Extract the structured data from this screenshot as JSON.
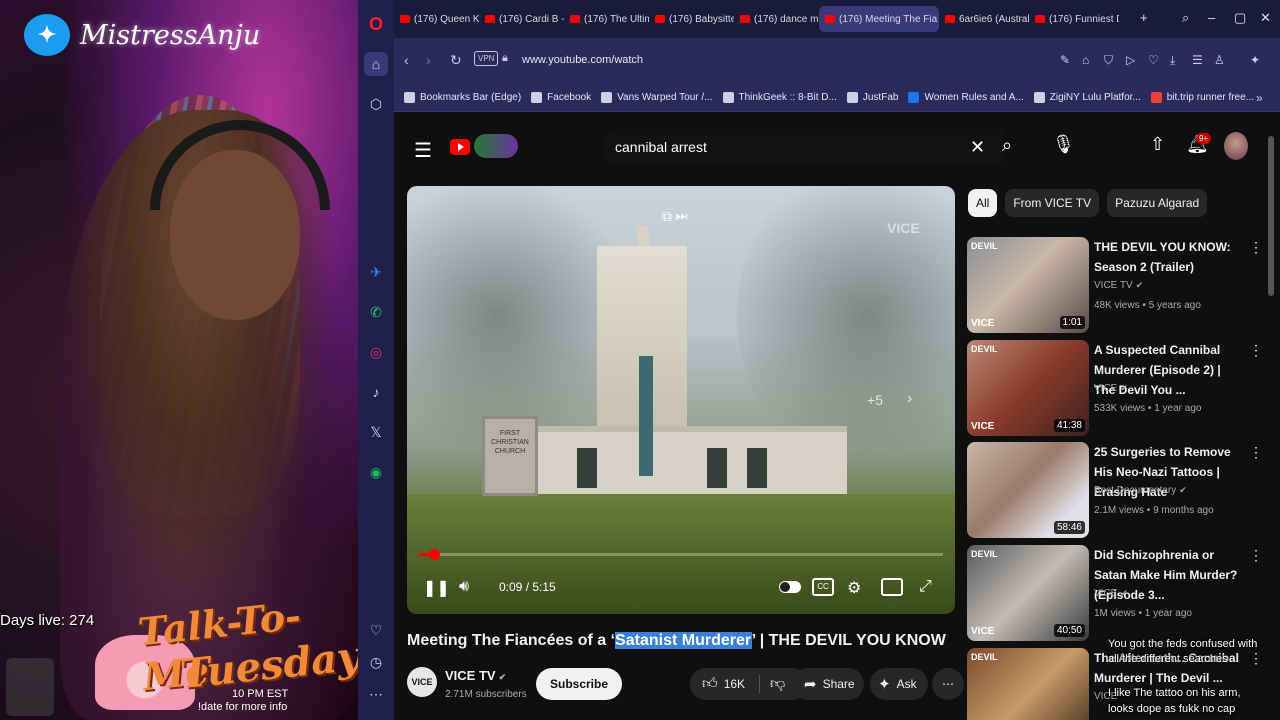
{
  "stream": {
    "handle": "MistressAnju",
    "days_live": "Days live: 274",
    "show_line1": "Talk-To-Me",
    "show_line2": "Tuesday's",
    "show_time": "10 PM EST",
    "show_cmd": "!date for more info"
  },
  "tabs": [
    {
      "label": "(176) Queen Key"
    },
    {
      "label": "(176) Cardi B - M"
    },
    {
      "label": "(176) The Ultima"
    },
    {
      "label": "(176) Babysitter"
    },
    {
      "label": "(176) dance mor"
    },
    {
      "label": "(176) Meeting The Fia",
      "active": true
    },
    {
      "label": "6ar6ie6 (Austral"
    },
    {
      "label": "(176) Funniest D"
    }
  ],
  "address": {
    "url": "www.youtube.com/watch",
    "vpn": "VPN"
  },
  "bookmarks": [
    {
      "label": "Bookmarks Bar (Edge)"
    },
    {
      "label": "Facebook"
    },
    {
      "label": "Vans Warped Tour /..."
    },
    {
      "label": "ThinkGeek :: 8-Bit D..."
    },
    {
      "label": "JustFab"
    },
    {
      "label": "Women Rules and A..."
    },
    {
      "label": "ZigiNY Lulu Platfor..."
    },
    {
      "label": "bit.trip runner free..."
    }
  ],
  "youtube": {
    "search_query": "cannibal arrest",
    "notif_badge": "9+",
    "player": {
      "time": "0:09 / 5:15",
      "progress": 0.029,
      "seek_hint": "+5",
      "sign_text": "FIRST CHRISTIAN CHURCH",
      "watermark": "VICE"
    },
    "video": {
      "title_before": "Meeting The Fiancées of a ‘",
      "title_highlight": "Satanist Murderer",
      "title_after": "’ | THE DEVIL YOU KNOW",
      "channel": "VICE TV",
      "channel_avatar": "VICE",
      "subscribers": "2.71M subscribers",
      "subscribe_label": "Subscribe",
      "likes": "16K",
      "share_label": "Share",
      "ask_label": "Ask"
    },
    "chips": [
      {
        "label": "All",
        "active": true
      },
      {
        "label": "From VICE TV"
      },
      {
        "label": "Pazuzu Algarad"
      }
    ],
    "recommendations": [
      {
        "title": "THE DEVIL YOU KNOW: Season 2 (Trailer)",
        "channel": "VICE TV",
        "meta": "48K views • 5 years ago",
        "duration": "1:01",
        "brand": "DEVIL",
        "vice": "VICE"
      },
      {
        "title": "A Suspected Cannibal Murderer (Episode 2) | The Devil You ...",
        "channel": "VICE",
        "meta": "533K views • 1 year ago",
        "duration": "41:38",
        "brand": "DEVIL",
        "vice": "VICE"
      },
      {
        "title": "25 Surgeries to Remove His Neo-Nazi Tattoos | Erasing Hate",
        "channel": "Best Documentary",
        "meta": "2.1M views • 9 months ago",
        "duration": "58:46",
        "brand": "",
        "vice": ""
      },
      {
        "title": "Did Schizophrenia or Satan Make Him Murder? (Episode 3...",
        "channel": "VICE",
        "meta": "1M views • 1 year ago",
        "duration": "40:50",
        "brand": "DEVIL",
        "vice": "VICE"
      },
      {
        "title": "The Aftermath... Cannibal Murderer | The Devil ...",
        "channel": "VICE",
        "meta": "",
        "duration": "",
        "brand": "DEVIL",
        "vice": ""
      }
    ]
  },
  "chat": {
    "line1": "You got the feds confused with",
    "line2": "all the different searches",
    "line3": "I like The tattoo on his arm,",
    "line4": "looks dope as fukk no cap"
  },
  "colors": {
    "yt_red": "#ff0000",
    "highlight": "#3a7fd9",
    "opera_bg": "#22204a"
  }
}
